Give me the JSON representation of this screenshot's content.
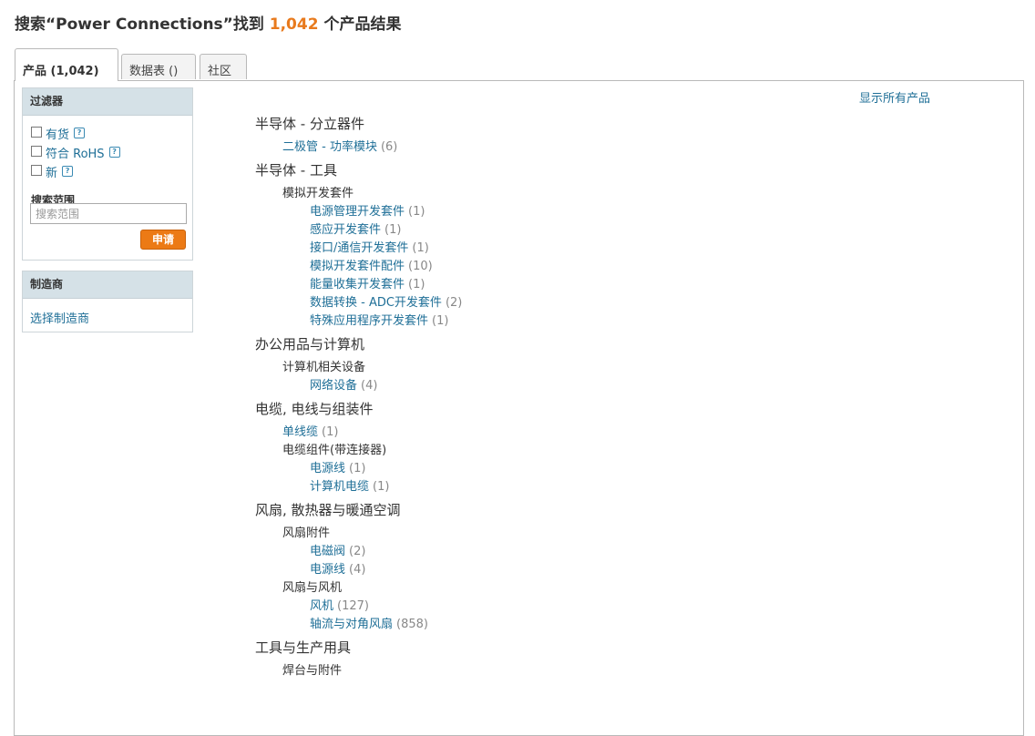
{
  "header": {
    "title_prefix": "搜索“Power Connections”找到",
    "result_count": "1,042",
    "title_suffix": "个产品结果"
  },
  "tabs": [
    {
      "label": "产品 (1,042)"
    },
    {
      "label": "数据表 ()"
    },
    {
      "label": "社区"
    }
  ],
  "filter_panel": {
    "title": "过滤器",
    "options": [
      {
        "label": "有货"
      },
      {
        "label": "符合 RoHS"
      },
      {
        "label": "新"
      }
    ],
    "help_glyph": "?",
    "scope_label": "搜索范围",
    "scope_placeholder": "搜索范围",
    "apply_label": "申请"
  },
  "manufacturer_panel": {
    "title": "制造商",
    "link": "选择制造商"
  },
  "show_all": "显示所有产品",
  "categories": [
    {
      "title": "半导体 - 分立器件",
      "rows": [
        {
          "label": "二极管 - 功率模块",
          "count": "(6)"
        }
      ]
    },
    {
      "title": "半导体 - 工具",
      "subcategory": "模拟开发套件",
      "rows": [
        {
          "label": "电源管理开发套件",
          "count": "(1)"
        },
        {
          "label": "感应开发套件",
          "count": "(1)"
        },
        {
          "label": "接口/通信开发套件",
          "count": "(1)"
        },
        {
          "label": "模拟开发套件配件",
          "count": "(10)"
        },
        {
          "label": "能量收集开发套件",
          "count": "(1)"
        },
        {
          "label": "数据转换 - ADC开发套件",
          "count": "(2)"
        },
        {
          "label": "特殊应用程序开发套件",
          "count": "(1)"
        }
      ]
    },
    {
      "title": "办公用品与计算机",
      "subcategory": "计算机相关设备",
      "rows": [
        {
          "label": "网络设备",
          "count": "(4)"
        }
      ]
    },
    {
      "title": "电缆, 电线与组装件",
      "top_row": {
        "label": "单线缆",
        "count": "(1)"
      },
      "subcategory": "电缆组件(带连接器)",
      "rows": [
        {
          "label": "电源线",
          "count": "(1)"
        },
        {
          "label": "计算机电缆",
          "count": "(1)"
        }
      ]
    },
    {
      "title": "风扇, 散热器与暖通空调",
      "subcategory": "风扇附件",
      "rows": [
        {
          "label": "电磁阀",
          "count": "(2)"
        },
        {
          "label": "电源线",
          "count": "(4)"
        }
      ],
      "subcategory2": "风扇与风机",
      "rows2": [
        {
          "label": "风机",
          "count": "(127)"
        },
        {
          "label": "轴流与对角风扇",
          "count": "(858)"
        }
      ]
    },
    {
      "title": "工具与生产用具",
      "subcategory": "焊台与附件"
    }
  ]
}
